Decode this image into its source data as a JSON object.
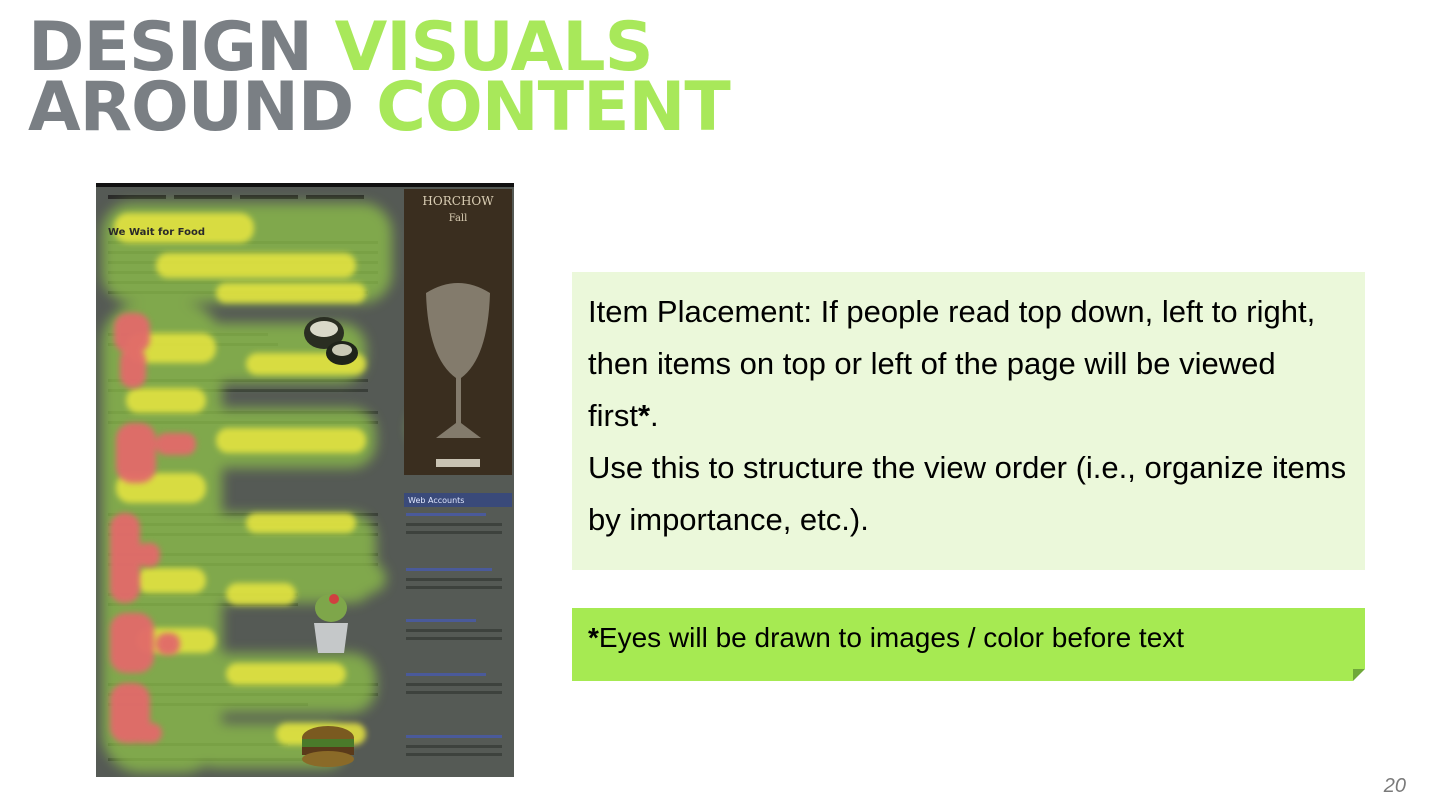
{
  "title": {
    "line1_gray": "DESIGN",
    "line1_green": "VISUALS",
    "line2_gray": "AROUND",
    "line2_green": "CONTENT"
  },
  "heatmap_image": {
    "headline": "We Wait for Food",
    "ad_brand": "HORCHOW",
    "ad_subtitle": "Fall",
    "sidebar_title": "Web Accounts"
  },
  "placement_box": {
    "text_1": "Item Placement:  If people read top down, left to right, then items on top or left of the page will be viewed first",
    "star": "*",
    "period": ".",
    "text_2": "Use this to structure the view order (i.e., organize items by importance, etc.)."
  },
  "note_box": {
    "star": "*",
    "text": "Eyes will be drawn to images / color before text"
  },
  "page_number": "20",
  "colors": {
    "title_gray": "#7a7f84",
    "title_green": "#a8e85a",
    "box_light_green": "#ebf8da",
    "box_bright_green": "#a6ea52"
  }
}
